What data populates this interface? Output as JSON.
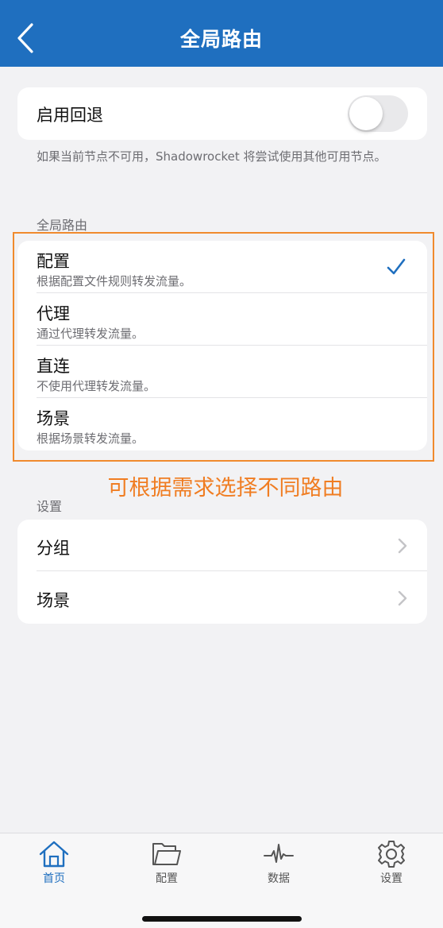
{
  "nav": {
    "title": "全局路由"
  },
  "fallback": {
    "label": "启用回退",
    "enabled": false,
    "footnote": "如果当前节点不可用，Shadowrocket 将尝试使用其他可用节点。"
  },
  "global_routing": {
    "header": "全局路由",
    "items": [
      {
        "title": "配置",
        "subtitle": "根据配置文件规则转发流量。",
        "selected": true
      },
      {
        "title": "代理",
        "subtitle": "通过代理转发流量。",
        "selected": false
      },
      {
        "title": "直连",
        "subtitle": "不使用代理转发流量。",
        "selected": false
      },
      {
        "title": "场景",
        "subtitle": "根据场景转发流量。",
        "selected": false
      }
    ]
  },
  "annotation": "可根据需求选择不同路由",
  "settings": {
    "header": "设置",
    "items": [
      {
        "label": "分组"
      },
      {
        "label": "场景"
      }
    ]
  },
  "tabbar": {
    "tabs": [
      {
        "label": "首页",
        "icon": "home-icon",
        "active": true
      },
      {
        "label": "配置",
        "icon": "folder-icon",
        "active": false
      },
      {
        "label": "数据",
        "icon": "pulse-icon",
        "active": false
      },
      {
        "label": "设置",
        "icon": "gear-icon",
        "active": false
      }
    ]
  },
  "colors": {
    "nav_bar": "#1f6fbf",
    "accent": "#1f6fbf",
    "annotation": "#f07d22",
    "background": "#f2f2f4"
  }
}
